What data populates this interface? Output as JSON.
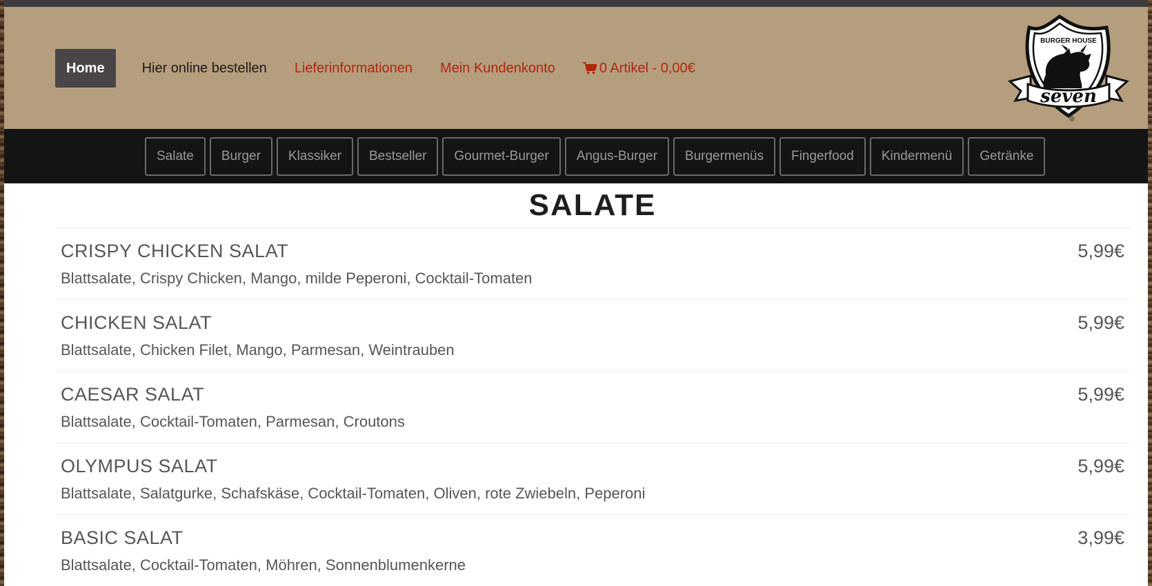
{
  "nav": {
    "home": "Home",
    "order_online": "Hier online bestellen",
    "delivery_info": "Lieferinformationen",
    "account": "Mein Kundenkonto",
    "cart": "0 Artikel - 0,00€"
  },
  "logo": {
    "top_text": "BURGER HOUSE",
    "main_text": "seven",
    "registered": "®"
  },
  "categories": [
    "Salate",
    "Burger",
    "Klassiker",
    "Bestseller",
    "Gourmet-Burger",
    "Angus-Burger",
    "Burgermenüs",
    "Fingerfood",
    "Kindermenü",
    "Getränke"
  ],
  "section": {
    "title": "SALATE"
  },
  "items": [
    {
      "name": "CRISPY CHICKEN SALAT",
      "description": "Blattsalate, Crispy Chicken, Mango, milde Peperoni, Cocktail-Tomaten",
      "price": "5,99€"
    },
    {
      "name": "CHICKEN SALAT",
      "description": "Blattsalate, Chicken Filet, Mango, Parmesan, Weintrauben",
      "price": "5,99€"
    },
    {
      "name": "CAESAR SALAT",
      "description": "Blattsalate, Cocktail-Tomaten, Parmesan, Croutons",
      "price": "5,99€"
    },
    {
      "name": "OLYMPUS SALAT",
      "description": "Blattsalate, Salatgurke, Schafskäse, Cocktail-Tomaten, Oliven, rote Zwiebeln, Peperoni",
      "price": "5,99€"
    },
    {
      "name": "BASIC SALAT",
      "description": "Blattsalate, Cocktail-Tomaten, Möhren, Sonnenblumenkerne",
      "price": "3,99€"
    }
  ],
  "colors": {
    "header_bg": "#b59e7d",
    "category_bar_bg": "#141414",
    "link_red": "#b3260c",
    "home_bg": "#4a4546"
  }
}
